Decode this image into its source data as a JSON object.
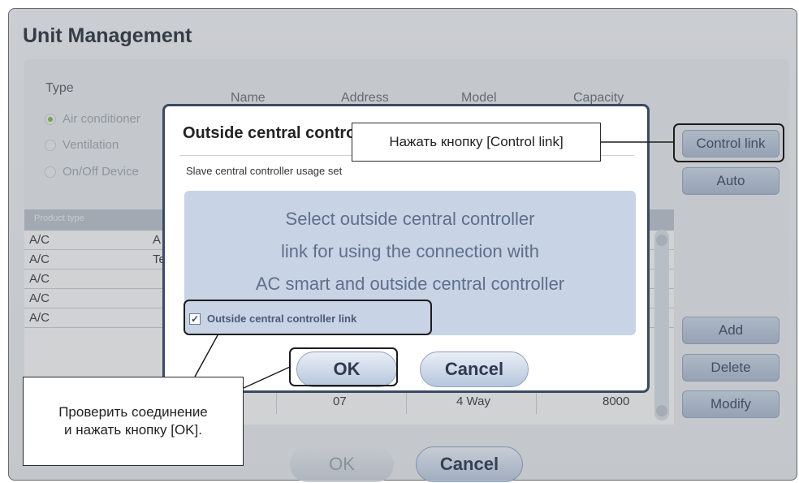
{
  "window": {
    "title": "Unit Management"
  },
  "type_section": {
    "label": "Type",
    "options": [
      {
        "label": "Air conditioner",
        "selected": true
      },
      {
        "label": "Ventilation",
        "selected": false
      },
      {
        "label": "On/Off Device",
        "selected": false
      }
    ]
  },
  "columns": [
    "Name",
    "Address",
    "Model",
    "Capacity"
  ],
  "side_buttons": {
    "control_link": "Control link",
    "auto": "Auto",
    "add": "Add",
    "delete": "Delete",
    "modify": "Modify"
  },
  "list": {
    "header": "Product type",
    "rows": [
      {
        "type": "A/C",
        "name": "A"
      },
      {
        "type": "A/C",
        "name": "Te"
      },
      {
        "type": "A/C",
        "name": ""
      },
      {
        "type": "A/C",
        "name": ""
      },
      {
        "type": "A/C",
        "name": ""
      }
    ],
    "last_row": {
      "address": "07",
      "model": "4 Way",
      "capacity": "8000"
    }
  },
  "bottom_buttons": {
    "ok": "OK",
    "cancel": "Cancel"
  },
  "dialog": {
    "title": "Outside central controller",
    "subtitle": "Slave central controller usage set",
    "message_lines": [
      "Select outside central controller",
      "link for using the connection with",
      "AC smart and outside central controller"
    ],
    "checkbox_label": "Outside central controller link",
    "checkbox_checked": true,
    "ok": "OK",
    "cancel": "Cancel"
  },
  "callouts": {
    "control_link": "Нажать кнопку [Control link]",
    "ok_line1": "Проверить соединение",
    "ok_line2": "и нажать кнопку [OK]."
  },
  "colors": {
    "dialog_border": "#3b4a63",
    "button_blue": "#b7c6dc",
    "radio_selected": "#7fb84a"
  }
}
